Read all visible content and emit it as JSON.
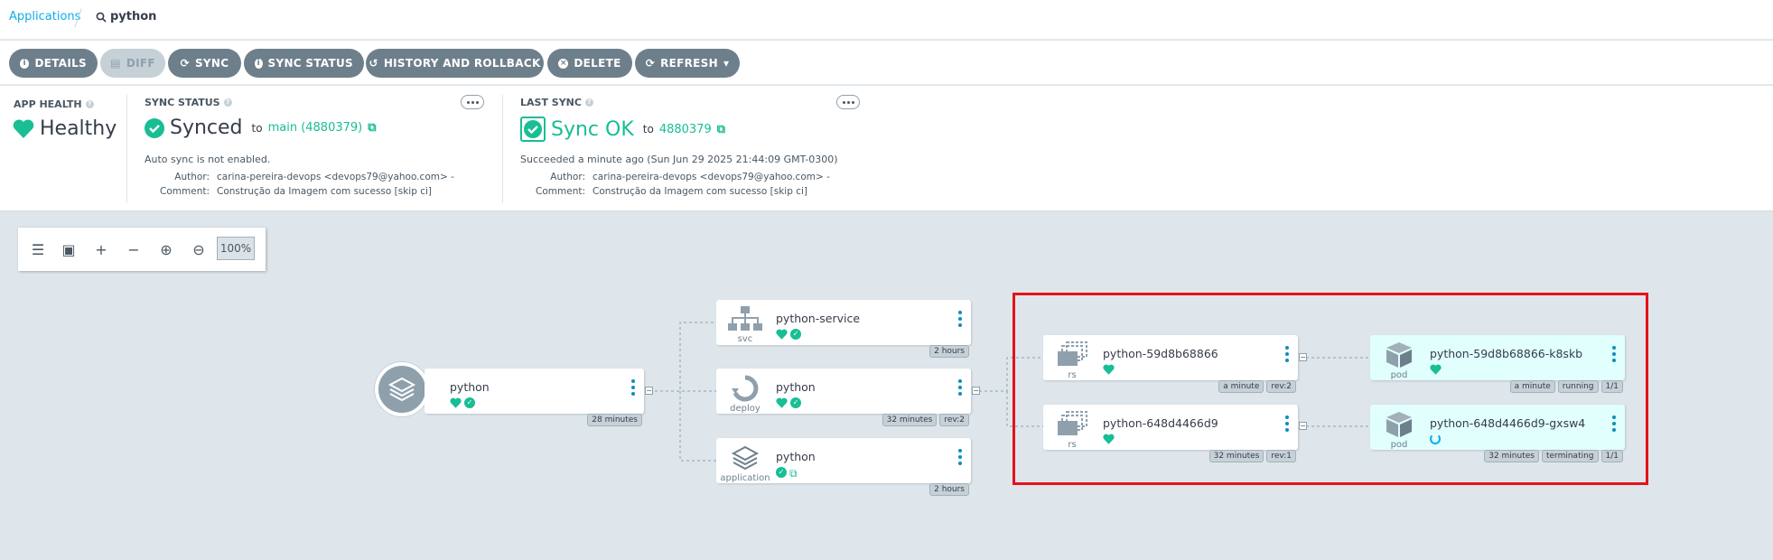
{
  "breadcrumb": {
    "applications": "Applications",
    "search": "python"
  },
  "toolbar": {
    "details": "DETAILS",
    "diff": "DIFF",
    "sync": "SYNC",
    "sync_status": "SYNC STATUS",
    "history": "HISTORY AND ROLLBACK",
    "delete": "DELETE",
    "refresh": "REFRESH"
  },
  "app_health": {
    "label": "APP HEALTH",
    "value": "Healthy"
  },
  "sync_status": {
    "label": "SYNC STATUS",
    "value": "Synced",
    "to": "to",
    "target": "main (4880379)",
    "auto_sync": "Auto sync is not enabled.",
    "author_label": "Author:",
    "author": "carina-pereira-devops <devops79@yahoo.com> -",
    "comment_label": "Comment:",
    "comment": "Construção da Imagem com sucesso [skip ci]"
  },
  "last_sync": {
    "label": "LAST SYNC",
    "value": "Sync OK",
    "to": "to",
    "revision": "4880379",
    "succeeded": "Succeeded a minute ago (Sun Jun 29 2025 21:44:09 GMT-0300)",
    "author_label": "Author:",
    "author": "carina-pereira-devops <devops79@yahoo.com> -",
    "comment_label": "Comment:",
    "comment": "Construção da Imagem com sucesso [skip ci]"
  },
  "graph": {
    "zoom": "100%",
    "root": {
      "name": "python",
      "age": "28 minutes"
    },
    "svc": {
      "name": "python-service",
      "kind": "svc",
      "age": "2 hours"
    },
    "deploy": {
      "name": "python",
      "kind": "deploy",
      "age": "32 minutes",
      "rev": "rev:2"
    },
    "application": {
      "name": "python",
      "kind": "application",
      "age": "2 hours"
    },
    "rs1": {
      "name": "python-59d8b68866",
      "kind": "rs",
      "age": "a minute",
      "rev": "rev:2"
    },
    "rs2": {
      "name": "python-648d4466d9",
      "kind": "rs",
      "age": "32 minutes",
      "rev": "rev:1"
    },
    "pod1": {
      "name": "python-59d8b68866-k8skb",
      "kind": "pod",
      "age": "a minute",
      "status": "running",
      "ready": "1/1"
    },
    "pod2": {
      "name": "python-648d4466d9-gxsw4",
      "kind": "pod",
      "age": "32 minutes",
      "status": "terminating",
      "ready": "1/1"
    }
  },
  "colors": {
    "healthy": "#18be94",
    "accent": "#0dadea",
    "button": "#6d7f8b",
    "highlight": "#e5121b"
  }
}
